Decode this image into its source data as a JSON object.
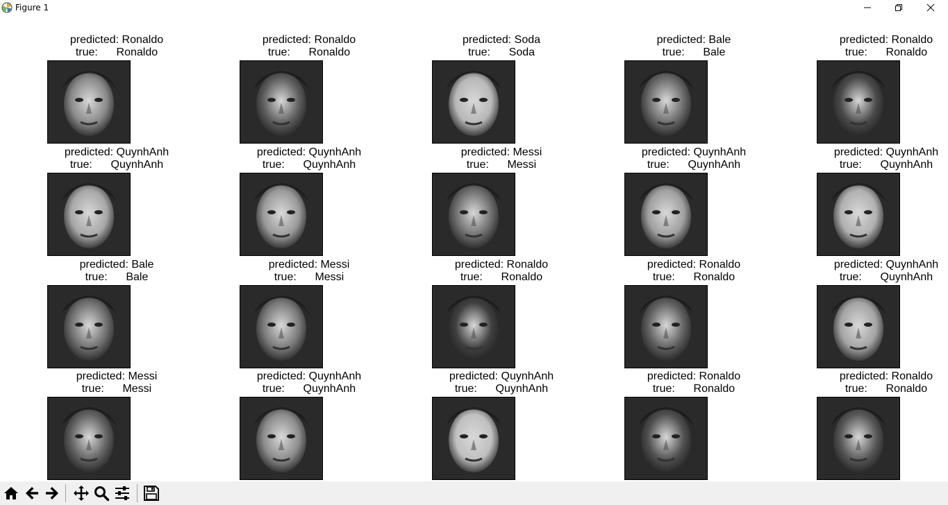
{
  "window": {
    "title": "Figure 1",
    "icons": [
      "matplotlib-app-icon",
      "minimize-icon",
      "restore-icon",
      "close-icon"
    ]
  },
  "grid": {
    "rows": [
      [
        {
          "predicted_line": "predicted: Ronaldo",
          "true_line": "true:      Ronaldo",
          "tone": "#8a8a8a"
        },
        {
          "predicted_line": "predicted: Ronaldo",
          "true_line": "true:      Ronaldo",
          "tone": "#5e5e5e"
        },
        {
          "predicted_line": "predicted: Soda",
          "true_line": "true:      Soda",
          "tone": "#b8b8b8"
        },
        {
          "predicted_line": "predicted: Bale",
          "true_line": "true:      Bale",
          "tone": "#6a6a6a"
        },
        {
          "predicted_line": "predicted: Ronaldo",
          "true_line": "true:      Ronaldo",
          "tone": "#4a4a4a"
        }
      ],
      [
        {
          "predicted_line": "predicted: QuynhAnh",
          "true_line": "true:      QuynhAnh",
          "tone": "#a8a8a8"
        },
        {
          "predicted_line": "predicted: QuynhAnh",
          "true_line": "true:      QuynhAnh",
          "tone": "#9a9a9a"
        },
        {
          "predicted_line": "predicted: Messi",
          "true_line": "true:      Messi",
          "tone": "#6e6e6e"
        },
        {
          "predicted_line": "predicted: QuynhAnh",
          "true_line": "true:      QuynhAnh",
          "tone": "#a0a0a0"
        },
        {
          "predicted_line": "predicted: QuynhAnh",
          "true_line": "true:      QuynhAnh",
          "tone": "#b0b0b0"
        }
      ],
      [
        {
          "predicted_line": "predicted: Bale",
          "true_line": "true:      Bale",
          "tone": "#707070"
        },
        {
          "predicted_line": "predicted: Messi",
          "true_line": "true:      Messi",
          "tone": "#7a7a7a"
        },
        {
          "predicted_line": "predicted: Ronaldo",
          "true_line": "true:      Ronaldo",
          "tone": "#404040"
        },
        {
          "predicted_line": "predicted: Ronaldo",
          "true_line": "true:      Ronaldo",
          "tone": "#606060"
        },
        {
          "predicted_line": "predicted: QuynhAnh",
          "true_line": "true:      QuynhAnh",
          "tone": "#a4a4a4"
        }
      ],
      [
        {
          "predicted_line": "predicted: Messi",
          "true_line": "true:      Messi",
          "tone": "#626262"
        },
        {
          "predicted_line": "predicted: QuynhAnh",
          "true_line": "true:      QuynhAnh",
          "tone": "#8c8c8c"
        },
        {
          "predicted_line": "predicted: QuynhAnh",
          "true_line": "true:      QuynhAnh",
          "tone": "#c0c0c0"
        },
        {
          "predicted_line": "predicted: Ronaldo",
          "true_line": "true:      Ronaldo",
          "tone": "#505050"
        },
        {
          "predicted_line": "predicted: Ronaldo",
          "true_line": "true:      Ronaldo",
          "tone": "#585858"
        }
      ]
    ]
  },
  "toolbar": {
    "buttons": [
      "home-icon",
      "back-arrow-icon",
      "forward-arrow-icon",
      "pan-move-icon",
      "zoom-magnifier-icon",
      "configure-subplots-icon",
      "save-floppy-icon"
    ]
  }
}
